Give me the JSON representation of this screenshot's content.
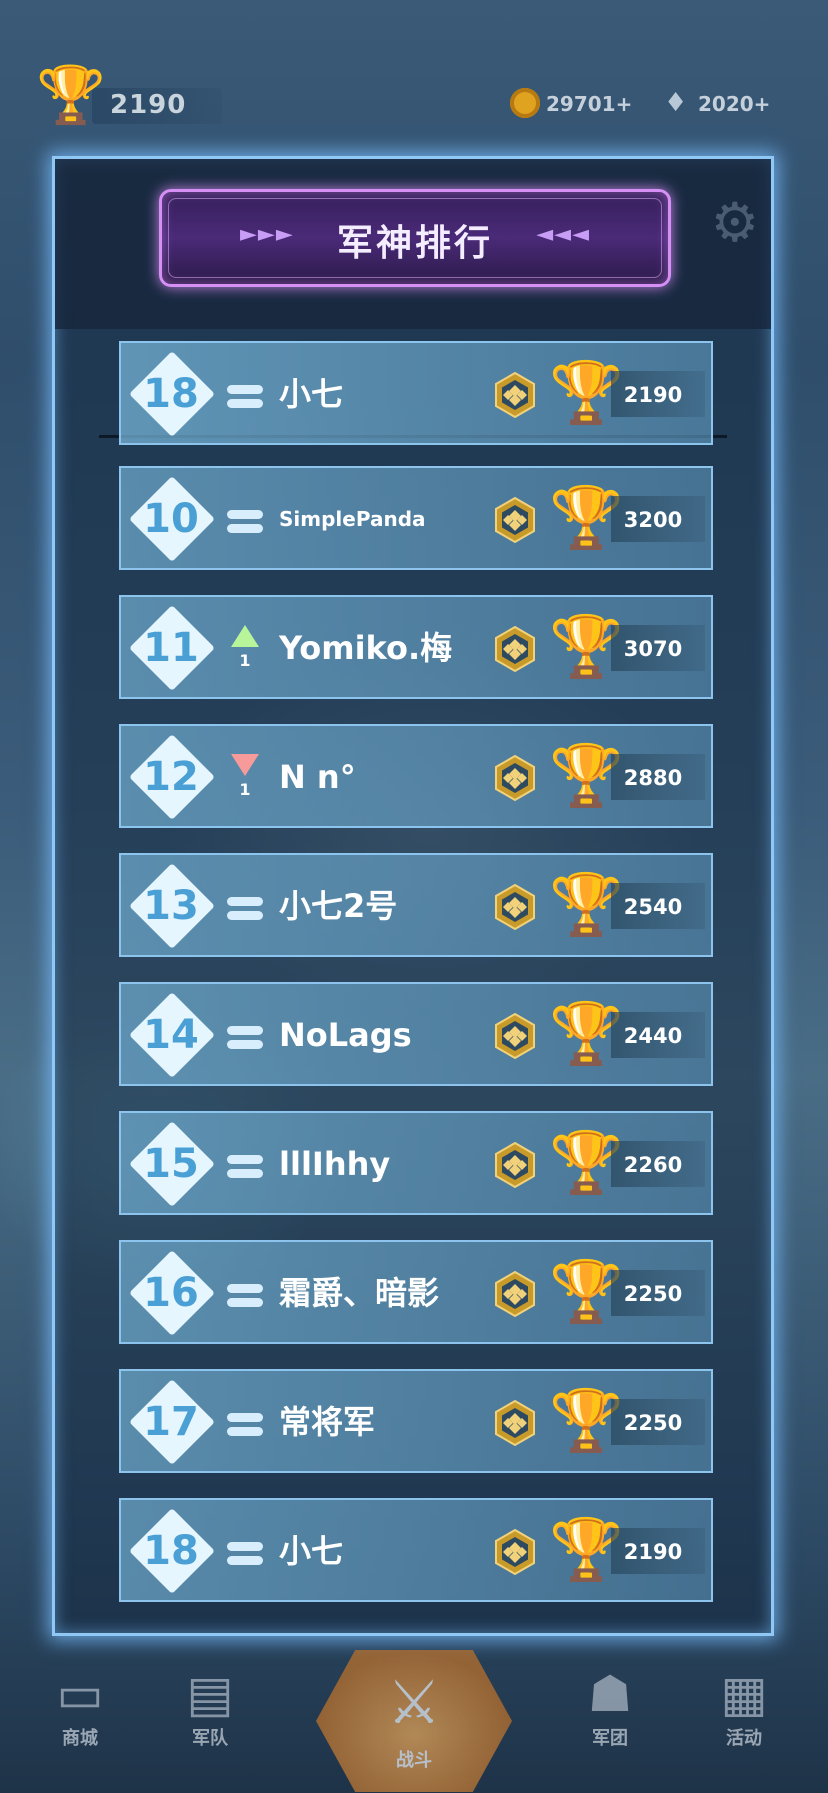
{
  "top_bar": {
    "trophy_score": "2190",
    "coins": "29701+",
    "gems": "2020+"
  },
  "panel": {
    "title": "军神排行",
    "title_arrows_left": "►►►",
    "title_arrows_right": "◄◄◄"
  },
  "rows": [
    {
      "rank": "18",
      "change": "same",
      "change_amount": "",
      "name": "小七",
      "score": "2190",
      "is_self": true
    },
    {
      "rank": "10",
      "change": "same",
      "change_amount": "",
      "name": "SimplePanda",
      "score": "3200"
    },
    {
      "rank": "11",
      "change": "up",
      "change_amount": "1",
      "name": "Yomiko.梅",
      "score": "3070"
    },
    {
      "rank": "12",
      "change": "down",
      "change_amount": "1",
      "name": "N n°",
      "score": "2880"
    },
    {
      "rank": "13",
      "change": "same",
      "change_amount": "",
      "name": "小七2号",
      "score": "2540"
    },
    {
      "rank": "14",
      "change": "same",
      "change_amount": "",
      "name": "NoLags",
      "score": "2440"
    },
    {
      "rank": "15",
      "change": "same",
      "change_amount": "",
      "name": "lllIhhy",
      "score": "2260"
    },
    {
      "rank": "16",
      "change": "same",
      "change_amount": "",
      "name": "霜爵、暗影",
      "score": "2250"
    },
    {
      "rank": "17",
      "change": "same",
      "change_amount": "",
      "name": "常将军",
      "score": "2250"
    },
    {
      "rank": "18",
      "change": "same",
      "change_amount": "",
      "name": "小七",
      "score": "2190"
    }
  ],
  "bottom_nav": {
    "items": [
      {
        "label": "商城",
        "icon": "shop-icon"
      },
      {
        "label": "军队",
        "icon": "cards-icon"
      },
      {
        "label": "战斗",
        "icon": "battle-icon"
      },
      {
        "label": "军团",
        "icon": "clan-icon"
      },
      {
        "label": "活动",
        "icon": "events-icon"
      }
    ]
  },
  "colors": {
    "panel_border": "#8fc8f5",
    "title_border": "#d68ff5",
    "trophy": "#f5c033",
    "rank_number": "#4aa0d4",
    "up_arrow": "#b8f59a",
    "down_arrow": "#f79a9a"
  }
}
